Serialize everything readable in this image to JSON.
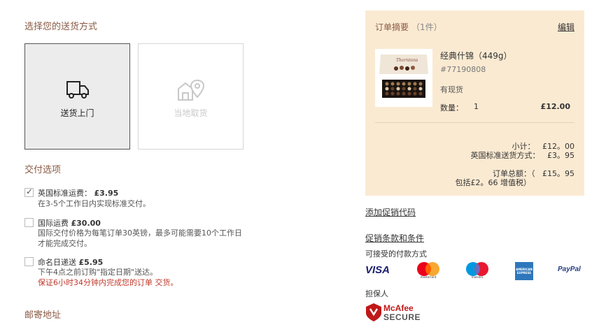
{
  "delivery": {
    "section_title": "选择您的送货方式",
    "option_home": "送货上门",
    "option_store": "当地取货"
  },
  "options": {
    "section_title": "交付选项",
    "items": [
      {
        "title": "英国标准运费：",
        "price": "£3.95",
        "desc": "在3-5个工作日内实现标准交付。",
        "checked": true
      },
      {
        "title": "国际运费",
        "price": "£30.00",
        "desc": "国际交付价格为每笔订单30英镑，最多可能需要10个工作日才能完成交付。",
        "checked": false
      },
      {
        "title": "命名日递送",
        "price": "£5.95",
        "desc": "下午4点之前订购\"指定日期\"送达。",
        "warn": "保证6小时34分钟内完成您的订单 交货。",
        "checked": false
      }
    ]
  },
  "postal": {
    "section_title": "邮寄地址"
  },
  "summary": {
    "title": "订单摘要",
    "count": "（1件）",
    "edit": "编辑",
    "product": {
      "name": "经典什锦（449g）",
      "sku": "#77190808",
      "stock": "有现货",
      "qty_label": "数量：",
      "qty": "1",
      "price": "£12.00",
      "image_brand": "Thorntons"
    },
    "subtotal_label": "小计：",
    "subtotal": "£12。00",
    "shipping_label": "英国标准送货方式：",
    "shipping": "£3。95",
    "total_label": "订单总额：（",
    "total": "£15。95",
    "vat_note": "包括£2。66 增值税）"
  },
  "promo": {
    "add_link": "添加促销代码",
    "terms_link": "促销条款和条件"
  },
  "payments": {
    "title": "可接受的付款方式",
    "visa": "VISA",
    "mastercard": "mastercard",
    "maestro": "maestro",
    "amex": "AMERICAN EXPRESS",
    "paypal": "PayPal"
  },
  "guarantor": {
    "title": "担保人",
    "brand": "McAfee",
    "sub": "SECURE"
  },
  "colors": {
    "accent": "#8a5a44",
    "summary_bg": "#fbead2",
    "warn": "#c0392b"
  }
}
